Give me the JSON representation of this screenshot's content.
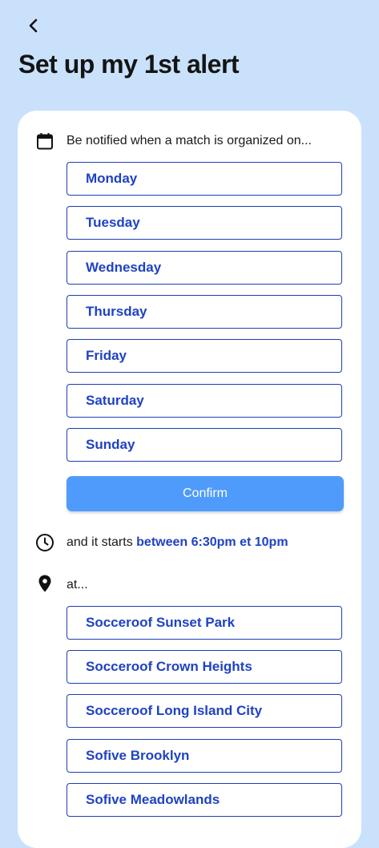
{
  "header": {
    "title": "Set up my 1st alert"
  },
  "days_section": {
    "label": "Be notified when a match is organized on...",
    "options": [
      "Monday",
      "Tuesday",
      "Wednesday",
      "Thursday",
      "Friday",
      "Saturday",
      "Sunday"
    ],
    "confirm_label": "Confirm"
  },
  "time_section": {
    "prefix": "and it starts",
    "value": "between 6:30pm et 10pm"
  },
  "location_section": {
    "label": "at...",
    "options": [
      "Socceroof Sunset Park",
      "Socceroof Crown Heights",
      "Socceroof Long Island City",
      "Sofive Brooklyn",
      "Sofive Meadowlands"
    ]
  },
  "colors": {
    "background": "#c9e1fb",
    "accent": "#1f42c4",
    "confirm": "#4f9bfb"
  }
}
